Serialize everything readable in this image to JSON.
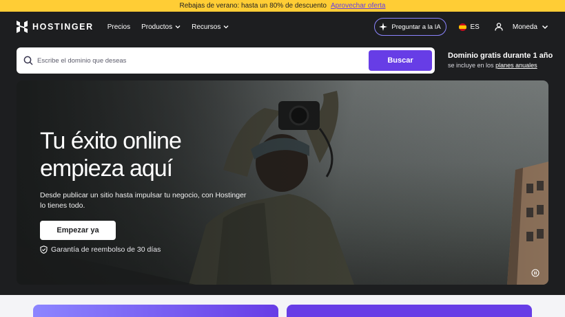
{
  "promo": {
    "text": "Rebajas de verano: hasta un 80% de descuento",
    "link": "Aprovechar oferta"
  },
  "nav": {
    "brand": "HOSTINGER",
    "links": [
      {
        "label": "Precios"
      },
      {
        "label": "Productos"
      },
      {
        "label": "Recursos"
      }
    ],
    "ai_button": "Preguntar a la IA",
    "language": "ES",
    "currency": "Moneda"
  },
  "search": {
    "placeholder": "Escribe el dominio que deseas",
    "button": "Buscar"
  },
  "domain_promo": {
    "title": "Dominio gratis durante 1 año",
    "sub_prefix": "se incluye en los",
    "sub_link": "planes anuales"
  },
  "hero": {
    "title_line1": "Tu éxito online",
    "title_line2": "empieza aquí",
    "description": "Desde publicar un sitio hasta impulsar tu negocio, con Hostinger lo tienes todo.",
    "cta": "Empezar ya",
    "guarantee": "Garantía de reembolso de 30 días"
  },
  "colors": {
    "primary": "#673de6",
    "promo_bg": "#ffcd35",
    "dark_bg": "#1d1e20",
    "ai_border": "#8c85ff"
  },
  "icons": [
    "hostinger-logo-icon",
    "chevron-down-icon",
    "sparkle-icon",
    "flag-es-icon",
    "user-icon",
    "search-icon",
    "shield-check-icon",
    "pause-icon"
  ]
}
